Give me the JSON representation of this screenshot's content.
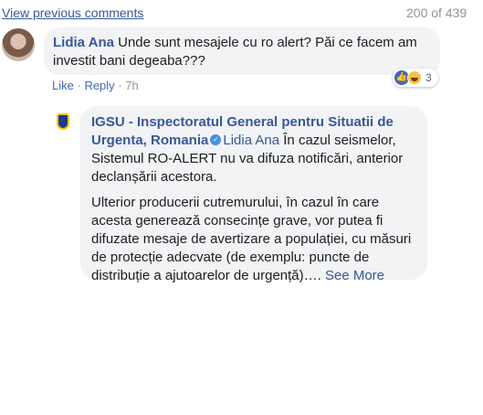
{
  "header": {
    "view_previous_label": "View previous comments",
    "comment_count": "200 of 439"
  },
  "comment1": {
    "author": "Lidia Ana",
    "text": "Unde sunt mesajele cu ro alert? Păi ce facem am investit bani degeaba???",
    "reactions": {
      "icons": [
        "like-icon",
        "haha-icon"
      ],
      "count": "3"
    },
    "actions": {
      "like": "Like",
      "reply": "Reply",
      "time": "7h"
    }
  },
  "reply": {
    "author": "IGSU - Inspectoratul General pentru Situatii de Urgenta, Romania",
    "verified_icon": "verified-badge-icon",
    "mention": "Lidia Ana",
    "text1": "În cazul seismelor, Sistemul RO-ALERT nu va difuza notificări, anterior declanșării acestora.",
    "text2": "Ulterior producerii cutremurului, în cazul în care acesta generează consecințe grave, vor putea fi difuzate mesaje de avertizare a populației, cu măsuri de protecție adecvate (de exemplu: puncte de distribuție a ajutoarelor de urgență)….",
    "see_more": "See More"
  },
  "colors": {
    "link": "#385898",
    "bubble": "#f2f3f5",
    "meta": "#90949c"
  }
}
